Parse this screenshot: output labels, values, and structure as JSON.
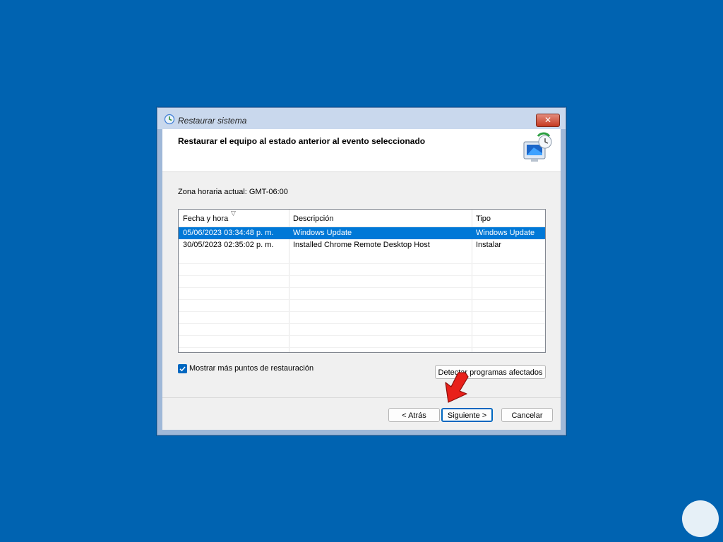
{
  "window": {
    "title": "Restaurar sistema",
    "close_label": "✕"
  },
  "header": {
    "title": "Restaurar el equipo al estado anterior al evento seleccionado"
  },
  "timezone_label": "Zona horaria actual: GMT-06:00",
  "table": {
    "columns": [
      "Fecha y hora",
      "Descripción",
      "Tipo"
    ],
    "rows": [
      {
        "date": "05/06/2023 03:34:48 p. m.",
        "description": "Windows Update",
        "type": "Windows Update",
        "selected": true
      },
      {
        "date": "30/05/2023 02:35:02 p. m.",
        "description": "Installed Chrome Remote Desktop Host",
        "type": "Instalar",
        "selected": false
      }
    ]
  },
  "checkbox": {
    "label": "Mostrar más puntos de restauración",
    "checked": true
  },
  "buttons": {
    "detect": "Detectar programas afectados",
    "back": "< Atrás",
    "next": "Siguiente >",
    "cancel": "Cancelar"
  },
  "colors": {
    "desktop": "#0063b1",
    "selection": "#0078d7",
    "arrow": "#e8201a"
  },
  "icons": [
    "system-restore-icon",
    "restore-monitor-icon",
    "checkmark-icon",
    "sort-down-icon",
    "pointer-arrow-icon"
  ]
}
